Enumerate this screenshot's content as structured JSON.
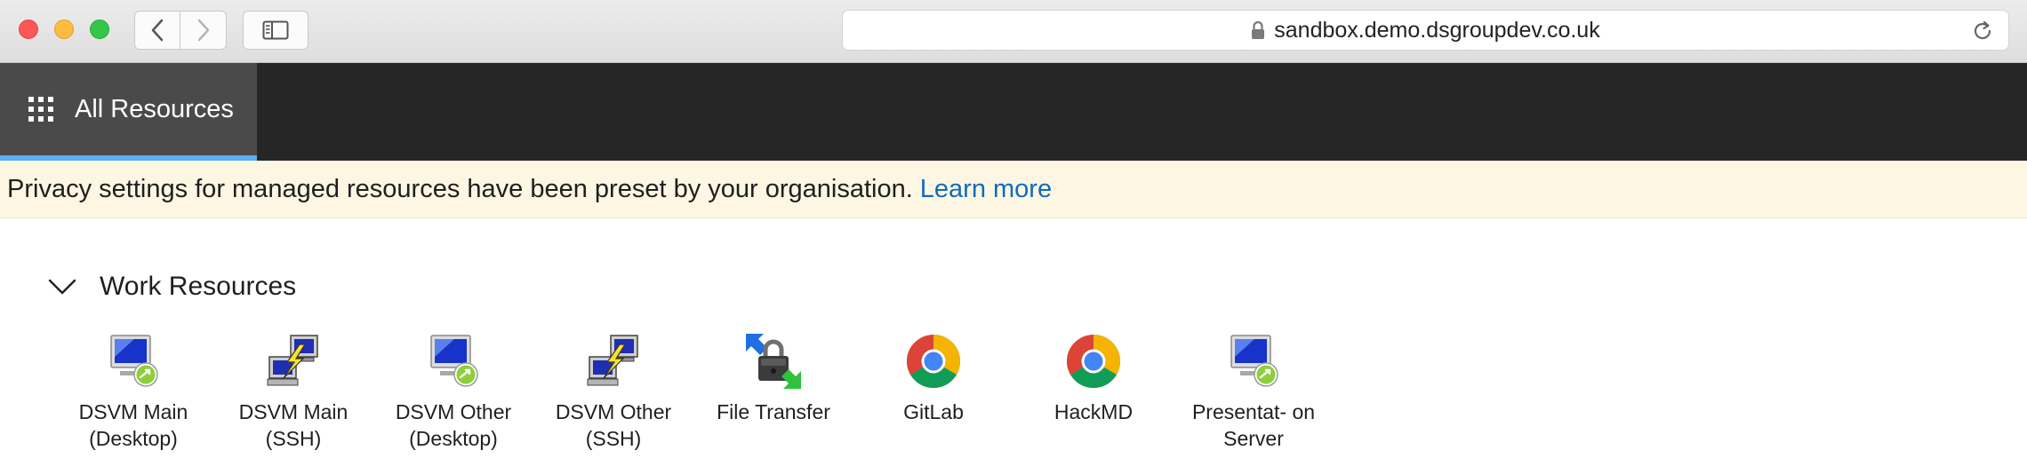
{
  "browser": {
    "url": "sandbox.demo.dsgroupdev.co.uk"
  },
  "nav": {
    "all_resources_label": "All Resources"
  },
  "banner": {
    "message": "Privacy settings for managed resources have been preset by your organisation.",
    "link_label": "Learn more"
  },
  "section": {
    "title": "Work Resources"
  },
  "resources": [
    {
      "label": "DSVM Main\n(Desktop)",
      "icon": "remote-desktop-icon"
    },
    {
      "label": "DSVM Main\n(SSH)",
      "icon": "ssh-terminal-icon"
    },
    {
      "label": "DSVM Other\n(Desktop)",
      "icon": "remote-desktop-icon"
    },
    {
      "label": "DSVM Other\n(SSH)",
      "icon": "ssh-terminal-icon"
    },
    {
      "label": "File Transfer",
      "icon": "file-transfer-icon"
    },
    {
      "label": "GitLab",
      "icon": "chrome-icon"
    },
    {
      "label": "HackMD",
      "icon": "chrome-icon"
    },
    {
      "label": "Presentat- on\nServer",
      "icon": "remote-desktop-icon"
    }
  ]
}
